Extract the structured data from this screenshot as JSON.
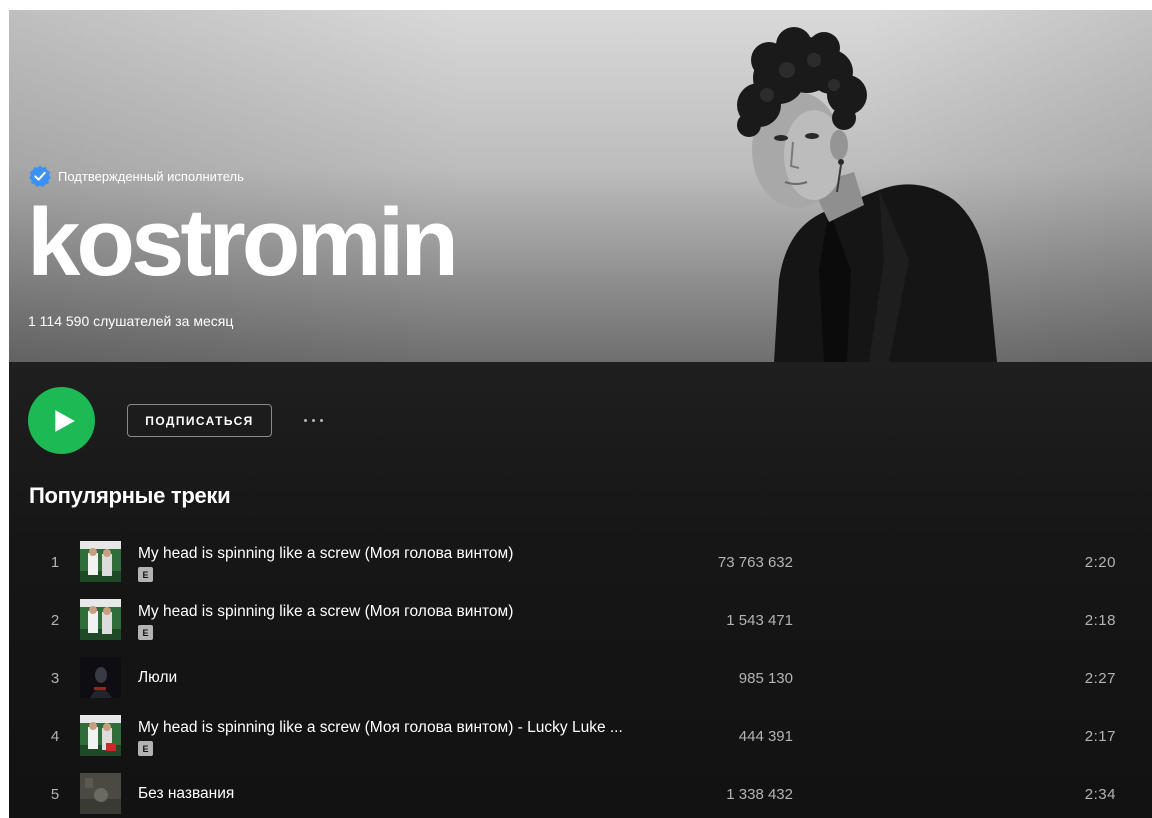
{
  "artist": {
    "verified_label": "Подтвержденный исполнитель",
    "name": "kostromin",
    "monthly_listeners": "1 114 590 слушателей за месяц"
  },
  "actions": {
    "play_icon": "play-icon",
    "follow_label": "ПОДПИСАТЬСЯ",
    "more_icon": "more-icon"
  },
  "popular": {
    "title": "Популярные треки",
    "tracks": [
      {
        "number": "1",
        "title": "My head is spinning like a screw (Моя голова винтом)",
        "explicit": "E",
        "plays": "73 763 632",
        "duration": "2:20"
      },
      {
        "number": "2",
        "title": "My head is spinning like a screw (Моя голова винтом)",
        "explicit": "E",
        "plays": "1 543 471",
        "duration": "2:18"
      },
      {
        "number": "3",
        "title": "Люли",
        "explicit": "",
        "plays": "985 130",
        "duration": "2:27"
      },
      {
        "number": "4",
        "title": "My head is spinning like a screw (Моя голова винтом) - Lucky Luke ...",
        "explicit": "E",
        "plays": "444 391",
        "duration": "2:17"
      },
      {
        "number": "5",
        "title": "Без названия",
        "explicit": "",
        "plays": "1 338 432",
        "duration": "2:34"
      }
    ]
  },
  "colors": {
    "accent": "#1db954",
    "verified_badge": "#3d91f4",
    "background": "#121212",
    "text_secondary": "#b3b3b3"
  }
}
